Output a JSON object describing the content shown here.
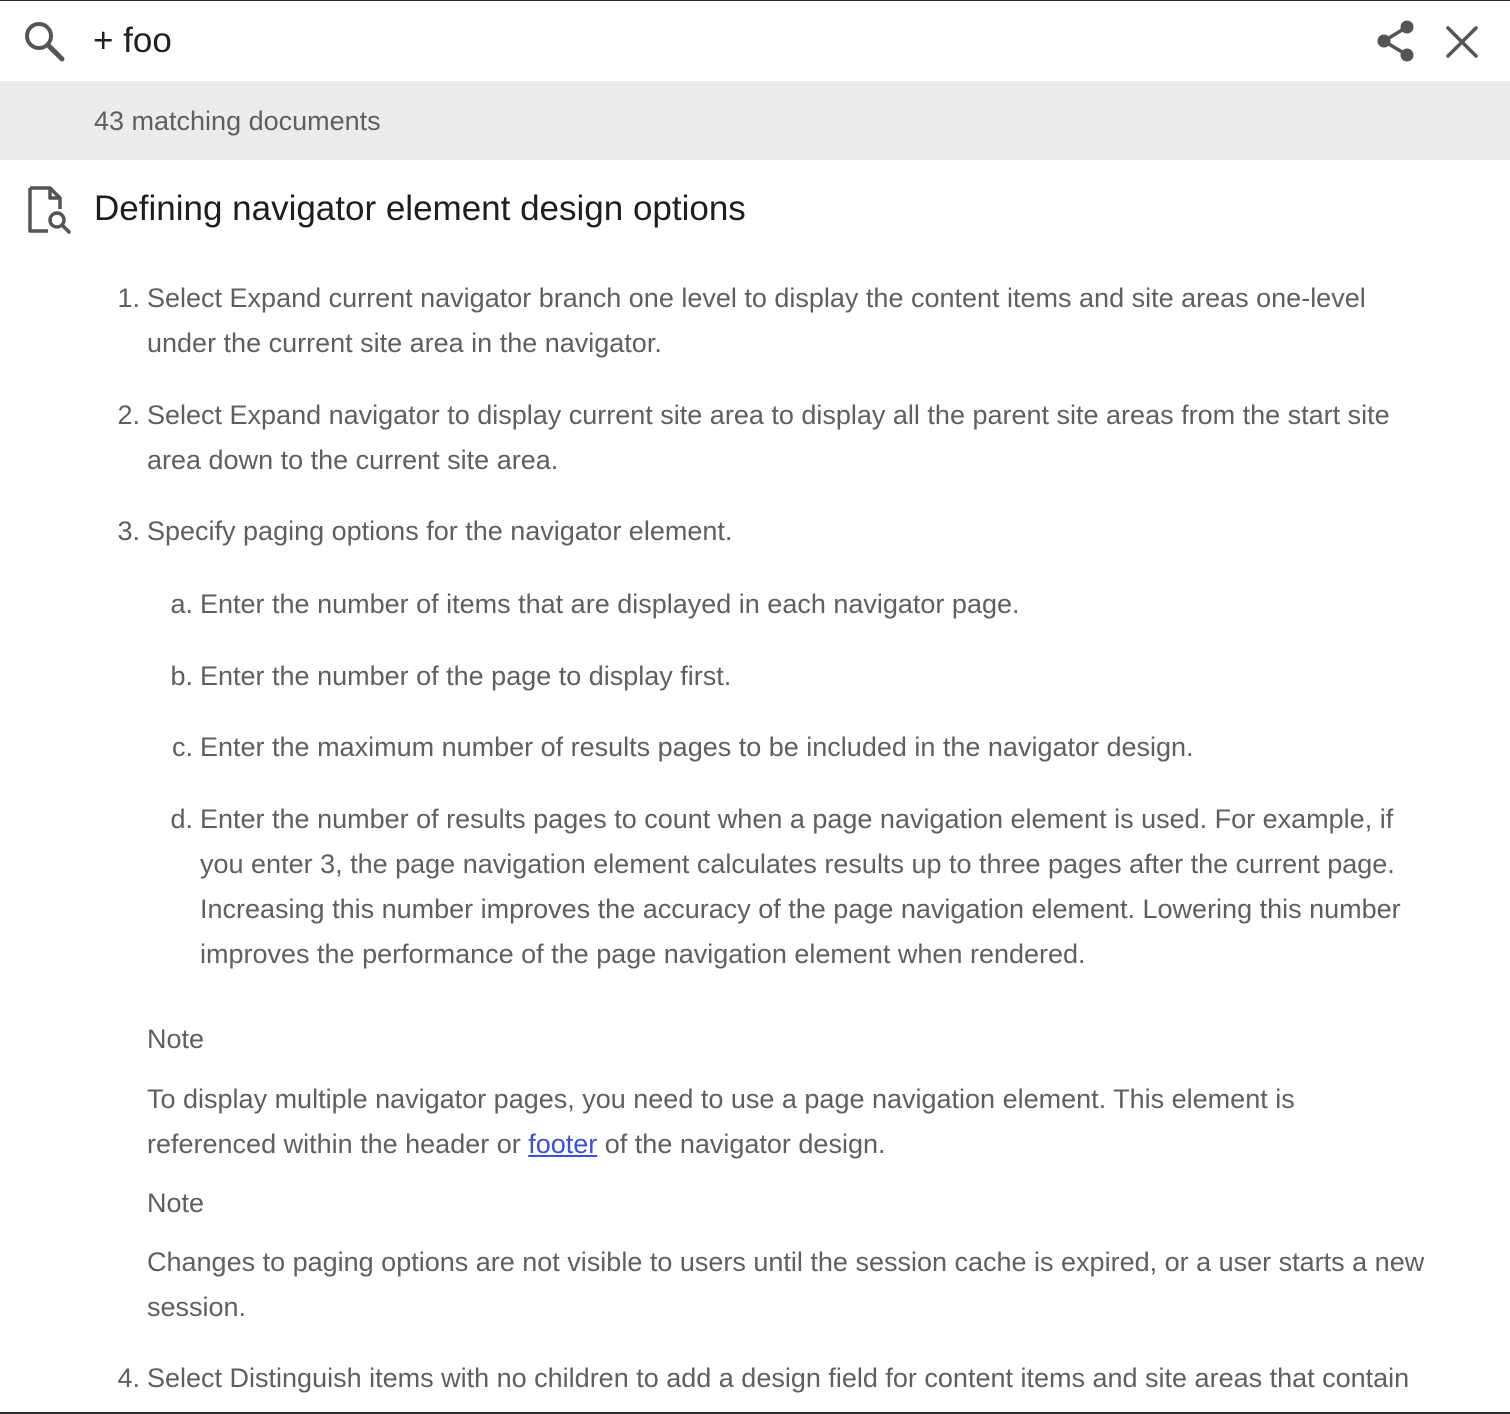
{
  "search": {
    "query": "+ foo"
  },
  "results": {
    "count_text": "43 matching documents"
  },
  "document": {
    "title": "Defining navigator element design options",
    "steps": [
      {
        "number": "1.",
        "lines": [
          "Select Expand current navigator branch one level to display the content items and site areas one-level",
          "under the current site area in the navigator."
        ]
      },
      {
        "number": "2.",
        "lines": [
          "Select Expand navigator to display current site area to display all the parent site areas from the start site",
          "area down to the current site area."
        ]
      },
      {
        "number": "3.",
        "lines": [
          "Specify paging options for the navigator element."
        ],
        "substeps": [
          {
            "letter": "a.",
            "lines": [
              "Enter the number of items that are displayed in each navigator page."
            ]
          },
          {
            "letter": "b.",
            "lines": [
              "Enter the number of the page to display first."
            ]
          },
          {
            "letter": "c.",
            "lines": [
              "Enter the maximum number of results pages to be included in the navigator design."
            ]
          },
          {
            "letter": "d.",
            "lines": [
              "Enter the number of results pages to count when a page navigation element is used. For example, if",
              "you enter 3, the page navigation element calculates results up to three pages after the current page.",
              "Increasing this number improves the accuracy of the page navigation element. Lowering this number",
              "improves the performance of the page navigation element when rendered."
            ]
          }
        ],
        "notes": [
          {
            "label": "Note",
            "line1": "To display multiple navigator pages, you need to use a page navigation element. This element is",
            "line2_before": "referenced within the header or ",
            "line2_link": "footer",
            "line2_after": " of the navigator design."
          },
          {
            "label": "Note",
            "line1": "Changes to paging options are not visible to users until the session cache is expired, or a user starts a new",
            "line2": "session."
          }
        ]
      },
      {
        "number": "4.",
        "lines": [
          "Select Distinguish items with no children to add a design field for content items and site areas that contain"
        ]
      }
    ]
  },
  "colors": {
    "accent_link": "#3b4fd8",
    "count_bar_bg": "#ececec",
    "body_text": "#5f5f5f"
  },
  "icons": {
    "search": "search-icon",
    "share": "share-icon",
    "close": "close-icon",
    "document": "document-search-icon"
  }
}
